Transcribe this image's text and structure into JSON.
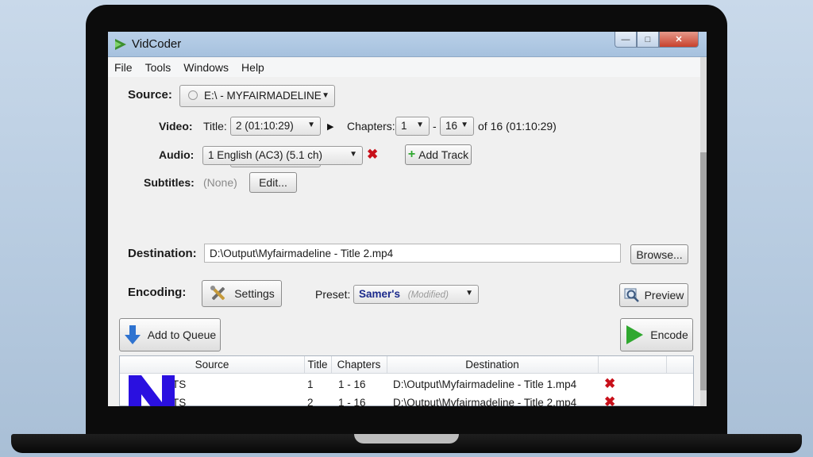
{
  "app": {
    "title": "VidCoder"
  },
  "window_controls": {
    "minimize": "—",
    "maximize": "□",
    "close": "✕"
  },
  "menu": [
    "File",
    "Tools",
    "Windows",
    "Help"
  ],
  "source": {
    "label": "Source:",
    "value": "E:\\ - MYFAIRMADELINE"
  },
  "video": {
    "label": "Video:",
    "title_label": "Title:",
    "title_value": "2 (01:10:29)",
    "chapters_label": "Chapters:",
    "chapter_start": "1",
    "dash": "-",
    "chapter_end": "16",
    "chapters_total": "of 16 (01:10:29)"
  },
  "audio": {
    "label": "Audio:",
    "track": "1 English (AC3) (5.1 ch)",
    "add_track": "Add Track"
  },
  "subtitles": {
    "label": "Subtitles:",
    "value": "(None)",
    "edit": "Edit..."
  },
  "destination": {
    "label": "Destination:",
    "path": "D:\\Output\\Myfairmadeline - Title 2.mp4",
    "browse": "Browse..."
  },
  "encoding": {
    "label": "Encoding:",
    "settings": "Settings",
    "preset_label": "Preset:",
    "preset_name": "Samer's",
    "preset_modifier": "(Modified)",
    "preview": "Preview"
  },
  "actions": {
    "add_to_queue": "Add to Queue",
    "encode": "Encode"
  },
  "queue": {
    "headers": {
      "source": "Source",
      "title": "Title",
      "chapters": "Chapters",
      "destination": "Destination"
    },
    "rows": [
      {
        "source": "TS",
        "title": "1",
        "chapters": "1 - 16",
        "destination": "D:\\Output\\Myfairmadeline - Title 1.mp4"
      },
      {
        "source": "TS",
        "title": "2",
        "chapters": "1 - 16",
        "destination": "D:\\Output\\Myfairmadeline - Title 2.mp4"
      }
    ]
  },
  "colors": {
    "titlebar": "#a6c1de",
    "remove_red": "#c8101a",
    "encode_green": "#2fa82f",
    "overlay_logo": "#2a10e0"
  }
}
